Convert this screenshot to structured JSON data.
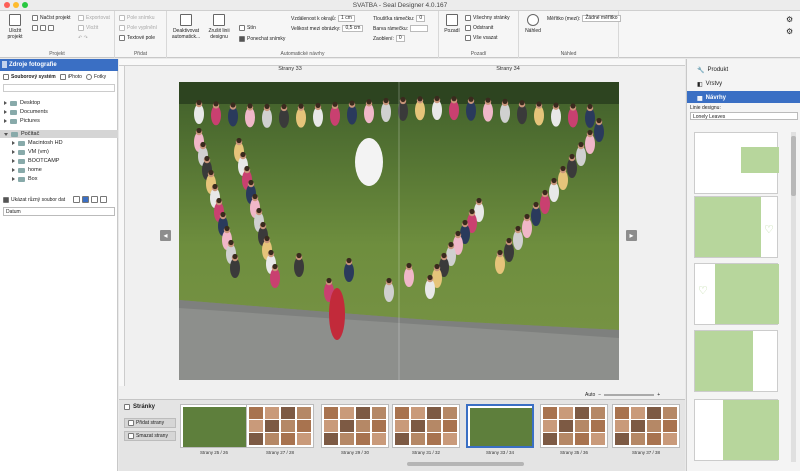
{
  "window": {
    "title": "SVATBA - Seal Designer 4.0.167"
  },
  "ribbon": {
    "project": {
      "label": "Projekt",
      "save_label": "Uložit projekt",
      "open_label": "Načíst projekt",
      "export_label": "Exportovat",
      "print_label": "Vložit"
    },
    "add": {
      "label": "Přidat",
      "photo_field": "Pole snímku",
      "empty_field": "Pole vyplnění",
      "text_field": "Textové pole"
    },
    "auto": {
      "label": "Automatické návrhy",
      "deactivate": "Deaktivovat automatick...",
      "show_lines": "Zrušit linii designu",
      "distance_edge_label": "Vzdálenost k okrajů:",
      "distance_edge_value": "1 cm",
      "distance_images_label": "Velikost mezi obrázky:",
      "distance_images_value": "0,5 cm",
      "shadow": "Stín",
      "move_images": "Ponechat snímky",
      "thickness_label": "Tloušťka rámečku:",
      "thickness_value": "0",
      "color_label": "Barva rámečku:",
      "rounding_label": "Zaoblení:",
      "rounding_value": "0"
    },
    "background": {
      "label": "Pozadí",
      "bg_btn": "Pozadí",
      "all_pages": "Všechny stránky",
      "remove": "Odstranit",
      "insert_all": "Vše vsazat"
    },
    "view": {
      "label": "Náhled",
      "preview": "Náhled",
      "measure_label": "Měřítko (mezi):",
      "measure_value": "Žádné měřítko"
    }
  },
  "left_panel": {
    "header": "Zdroje fotografie",
    "tabs": [
      "Souborový systém",
      "iPhoto",
      "Fotky"
    ],
    "tree": [
      {
        "label": "Desktop",
        "indent": 0,
        "open": false
      },
      {
        "label": "Documents",
        "indent": 0,
        "open": false
      },
      {
        "label": "Pictures",
        "indent": 0,
        "open": false
      },
      {
        "label": "Počítač",
        "indent": 0,
        "open": true,
        "selected": true
      },
      {
        "label": "Macintosh HD",
        "indent": 1,
        "open": false
      },
      {
        "label": "VM (vm)",
        "indent": 1,
        "open": false
      },
      {
        "label": "BOOTCAMP",
        "indent": 1,
        "open": false
      },
      {
        "label": "home",
        "indent": 1,
        "open": false
      },
      {
        "label": "Box",
        "indent": 1,
        "open": false
      }
    ],
    "show_types_label": "Ukázat různý soubor dat",
    "sort_value": "Datum"
  },
  "center": {
    "page_left": "Strany 33",
    "page_right": "Strany 34",
    "zoom_label": "Auto"
  },
  "right_panel": {
    "tabs": [
      "Produkt",
      "Vrstvy",
      "Návrhy"
    ],
    "design_line_label": "Linie designu:",
    "design_line_value": "Lonely Leaves"
  },
  "bottom": {
    "header": "Stránky",
    "add_pages": "Přidat strany",
    "remove_pages": "Smazat strany",
    "thumbs": [
      "Strany 25 / 26",
      "Strany 27 / 28",
      "Strany 29 / 30",
      "Strany 31 / 32",
      "Strany 33 / 34",
      "Strany 35 / 36",
      "Strany 37 / 38"
    ]
  },
  "colors": {
    "accent": "#3a6fc4",
    "leaf_green": "#b7d69c"
  }
}
